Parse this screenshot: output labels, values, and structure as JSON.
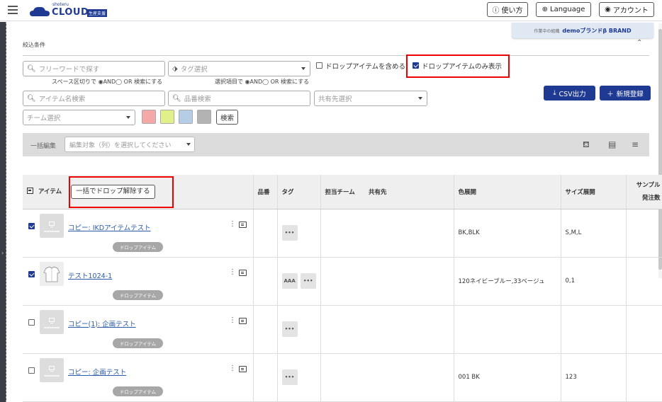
{
  "header": {
    "logo_small": "shoteru",
    "logo_text": "CLOUD",
    "logo_badge": "生産支援",
    "help_label": "使い方",
    "language_label": "Language",
    "account_label": "アカウント"
  },
  "brand": {
    "label": "作業中の組織",
    "value": "demoブランドβ BRAND"
  },
  "filter": {
    "section_title": "絞込条件",
    "freeword_placeholder": "フリーワードで探す",
    "freeword_hint": "スペース区切りで ◉AND◯ OR 検索にする",
    "tag_placeholder": "タグ選択",
    "tag_hint": "選択項目で ◉AND◯ OR 検索にする",
    "include_drop_label": "ドロップアイテムを含める",
    "include_drop_checked": false,
    "drop_only_label": "ドロップアイテムのみ表示",
    "drop_only_checked": true,
    "item_name_placeholder": "アイテム名検索",
    "part_no_placeholder": "品番検索",
    "share_placeholder": "共有先選択",
    "team_placeholder": "チーム選択",
    "swatches": [
      "#f4a9a8",
      "#e2f08a",
      "#b5cde6",
      "#b3b3b3"
    ],
    "search_label": "検索"
  },
  "actions": {
    "csv_label": "CSV出力",
    "new_label": "新規登録"
  },
  "bulk": {
    "label": "一括編集",
    "select_placeholder": "編集対象（列）を選択してください"
  },
  "table": {
    "headers": {
      "item": "アイテム",
      "bulk_drop": "一括でドロップ解除する",
      "part_no": "品番",
      "tag": "タグ",
      "team": "担当チーム",
      "share": "共有先",
      "color": "色展開",
      "size": "サイズ展開",
      "sample_a": "サンプル",
      "sample_b": "発注数"
    },
    "rows": [
      {
        "checked": true,
        "name": "コピー: IKDアイテムテスト",
        "badge": "ドロップアイテム",
        "tags": [
          "•••"
        ],
        "color": "BK,BLK",
        "size": "S,M,L"
      },
      {
        "checked": true,
        "name": "テスト1024-1",
        "badge": "ドロップアイテム",
        "tags": [
          "AAA",
          "•••"
        ],
        "color": "120ネイビーブルー,33ベージュ",
        "size": "0,1"
      },
      {
        "checked": false,
        "name": "コピー(1): 企画テスト",
        "badge": "ドロップアイテム",
        "tags": [
          "•••"
        ],
        "color": "",
        "size": ""
      },
      {
        "checked": false,
        "name": "コピー: 企画テスト",
        "badge": "ドロップアイテム",
        "tags": [
          "•••"
        ],
        "color": "001 BK",
        "size": "123"
      }
    ]
  },
  "colors": {
    "primary": "#1f3a93",
    "highlight": "#e00000"
  }
}
